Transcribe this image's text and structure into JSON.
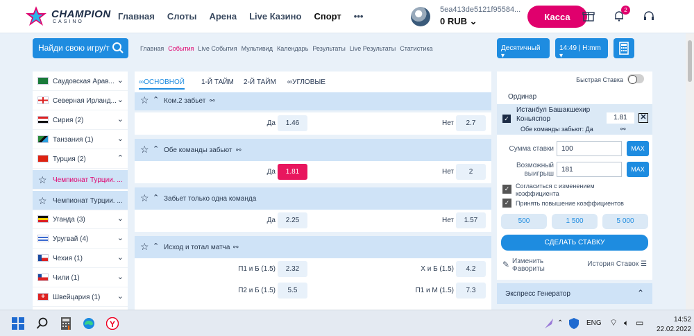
{
  "header": {
    "logo_text": "CHAMPION",
    "logo_sub": "CASINO",
    "nav": [
      "Главная",
      "Слоты",
      "Арена",
      "Live Казино",
      "Спорт"
    ],
    "more": "•••",
    "account_id": "5ea413de5121f95584...",
    "balance": "0 RUB",
    "kassa": "Касса",
    "notif_count": "2"
  },
  "subbar": {
    "search_label": "Найди свою игру/т",
    "links": [
      "Главная",
      "События",
      "Live События",
      "Мультивид",
      "Календарь",
      "Результаты",
      "Live Результаты",
      "Статистика"
    ],
    "odds_format": "Десятичный",
    "time_format": "14:49 | Н:mm"
  },
  "sidebar": {
    "items": [
      {
        "label": "Саудовская Арав...",
        "chev": "⌄"
      },
      {
        "label": "Северная Ирланд...",
        "chev": "⌄"
      },
      {
        "label": "Сирия (2)",
        "chev": "⌄"
      },
      {
        "label": "Танзания (1)",
        "chev": "⌄"
      },
      {
        "label": "Турция (2)",
        "chev": "⌃"
      },
      {
        "label": "Чемпионат Турции. ...",
        "chev": ""
      },
      {
        "label": "Чемпионат Турции. ...",
        "chev": ""
      },
      {
        "label": "Уганда (3)",
        "chev": "⌄"
      },
      {
        "label": "Уругвай (4)",
        "chev": "⌄"
      },
      {
        "label": "Чехия (1)",
        "chev": "⌄"
      },
      {
        "label": "Чили (1)",
        "chev": "⌄"
      },
      {
        "label": "Швейцария (1)",
        "chev": "⌄"
      }
    ]
  },
  "main": {
    "tabs": [
      "ОСНОВНОЙ",
      "1-Й ТАЙМ",
      "2-Й ТАЙМ",
      "УГЛОВЫЕ"
    ],
    "markets": [
      {
        "name": "Ком.2 забьет",
        "left_label": "Да",
        "left_odd": "1.46",
        "right_label": "Нет",
        "right_odd": "2.7"
      },
      {
        "name": "Обе команды забьют",
        "left_label": "Да",
        "left_odd": "1.81",
        "right_label": "Нет",
        "right_odd": "2"
      },
      {
        "name": "Забьет только одна команда",
        "left_label": "Да",
        "left_odd": "2.25",
        "right_label": "Нет",
        "right_odd": "1.57"
      },
      {
        "name": "Исход и тотал матча"
      }
    ],
    "result_rows": [
      {
        "l1": "П1 и Б (1.5)",
        "o1": "2.32",
        "l2": "Х и Б (1.5)",
        "o2": "4.2"
      },
      {
        "l1": "П2 и Б (1.5)",
        "o1": "5.5",
        "l2": "П1 и М (1.5)",
        "o2": "7.3"
      }
    ]
  },
  "coupon": {
    "quick_bet": "Быстрая Ставка",
    "ordinar": "Ординар",
    "match_line1": "Истанбул Башакшехир",
    "match_line2": "Коньяспор",
    "selection": "Обе команды забьют: Да",
    "coef": "1.81",
    "stake_label": "Сумма ставки",
    "stake_value": "100",
    "win_label1": "Возможный",
    "win_label2": "выигрыш",
    "win_value": "181",
    "max": "MAX",
    "opt1_a": "Согласиться с изменением",
    "opt1_b": "коэффициента",
    "opt2": "Принять повышение коэффициентов",
    "amounts": [
      "500",
      "1 500",
      "5 000"
    ],
    "place_bet": "СДЕЛАТЬ СТАВКУ",
    "fav_a": "Изменить",
    "fav_b": "Фавориты",
    "history": "История Ставок",
    "express": "Экспресс Генератор"
  },
  "taskbar": {
    "lang": "ENG",
    "time": "14:52",
    "date": "22.02.2022"
  }
}
